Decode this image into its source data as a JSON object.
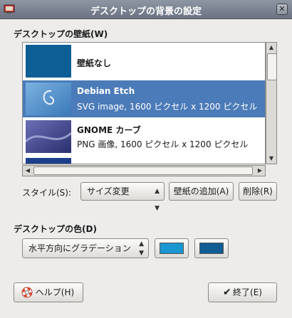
{
  "window": {
    "title": "デスクトップの背景の設定",
    "close_glyph": "✕"
  },
  "wallpaper_section": {
    "heading": "デスクトップの壁紙(W)"
  },
  "wallpapers": [
    {
      "name": "壁紙なし",
      "detail": ""
    },
    {
      "name": "Debian Etch",
      "detail": "SVG image, 1600 ピクセル x 1200 ピクセル"
    },
    {
      "name": "GNOME カーブ",
      "detail": "PNG 画像, 1600 ピクセル x 1200 ピクセル"
    }
  ],
  "selected_wallpaper": "Debian Etch",
  "controls": {
    "style_label": "スタイル(S):",
    "style_value": "サイズ変更",
    "add_button": "壁紙の追加(A)",
    "delete_button": "削除(R)"
  },
  "color_section": {
    "heading": "デスクトップの色(D)",
    "gradient_value": "水平方向にグラデーション",
    "primary_color": "#1a96d0",
    "secondary_color": "#0f5d94"
  },
  "footer": {
    "help_button": "ヘルプ(H)",
    "close_button": "終了(E)"
  },
  "icons": {
    "window_icon": "desktop-settings-icon",
    "help_icon": "lifebuoy-icon",
    "close_icon": "checkmark-icon"
  }
}
